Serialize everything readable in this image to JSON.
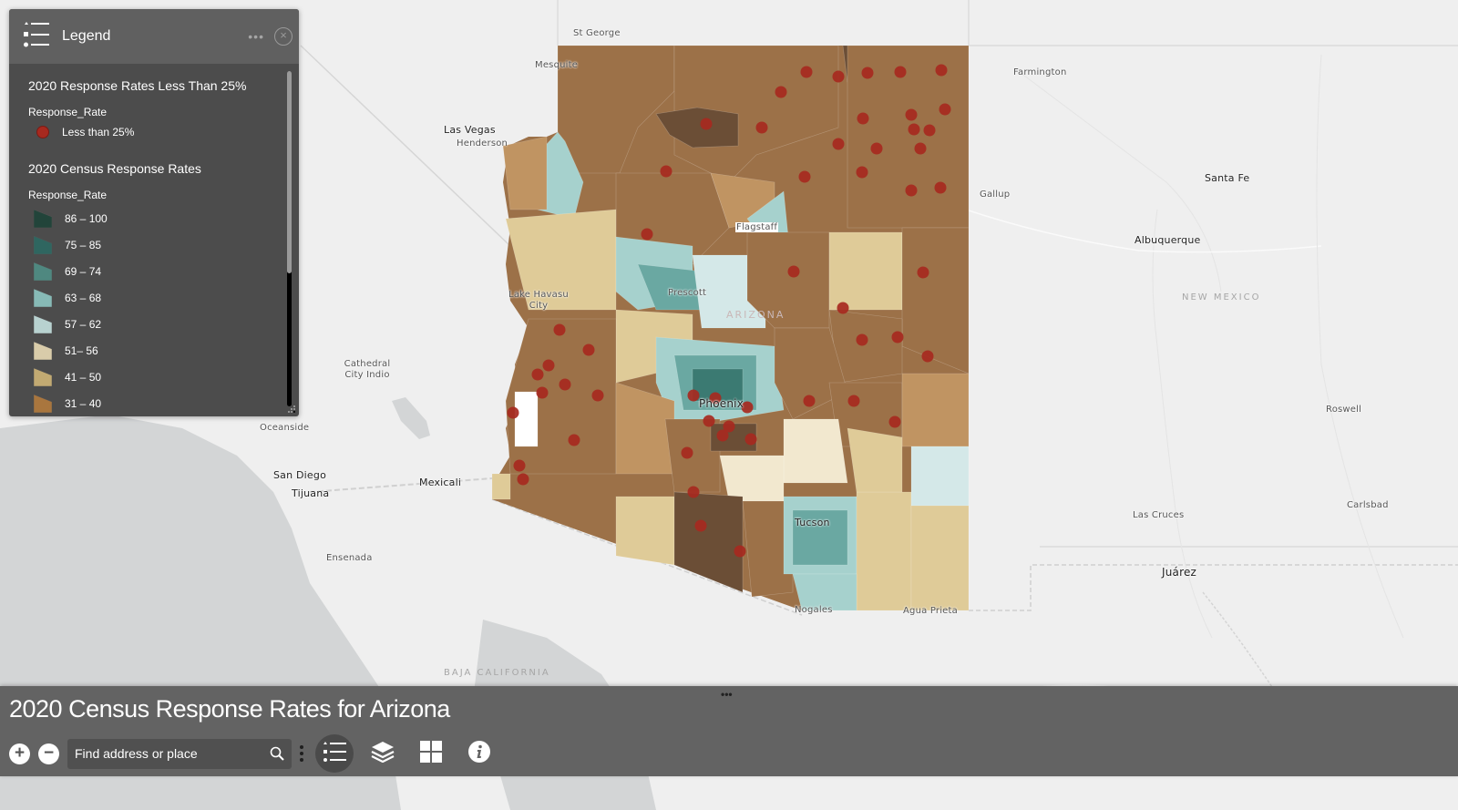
{
  "app": {
    "title": "2020 Census Response Rates for Arizona"
  },
  "legend": {
    "title": "Legend",
    "more_label": "•••",
    "close_label": "×",
    "layers": [
      {
        "name": "2020 Response Rates Less Than 25%",
        "field": "Response_Rate",
        "items": [
          {
            "label": "Less than 25%",
            "color": "#a7291f",
            "symbol": "circle"
          }
        ]
      },
      {
        "name": "2020 Census Response Rates",
        "field": "Response_Rate",
        "items": [
          {
            "label": "86 – 100",
            "color": "#22443a"
          },
          {
            "label": "75 – 85",
            "color": "#2f6660"
          },
          {
            "label": "69 – 74",
            "color": "#4f8880"
          },
          {
            "label": "63 – 68",
            "color": "#87bab6"
          },
          {
            "label": "57 – 62",
            "color": "#b8d2d0"
          },
          {
            "label": "51– 56",
            "color": "#d9ccaa"
          },
          {
            "label": "41 – 50",
            "color": "#c2aa72"
          },
          {
            "label": "31 – 40",
            "color": "#a9763e"
          }
        ]
      }
    ]
  },
  "toolbar": {
    "zoom_in_label": "+",
    "zoom_out_label": "−",
    "search_placeholder": "Find address or place",
    "search_value": "",
    "buttons": [
      {
        "name": "legend",
        "icon": "legend-list-icon",
        "active": true
      },
      {
        "name": "layers",
        "icon": "layers-icon",
        "active": false
      },
      {
        "name": "basemap-gallery",
        "icon": "grid-icon",
        "active": false
      },
      {
        "name": "about",
        "icon": "info-icon",
        "active": false
      }
    ]
  },
  "map": {
    "state_label": "ARIZONA",
    "places": [
      {
        "name": "St George",
        "type": "minor"
      },
      {
        "name": "Mesquite",
        "type": "minor"
      },
      {
        "name": "Las Vegas",
        "type": "city"
      },
      {
        "name": "Henderson",
        "type": "minor"
      },
      {
        "name": "Farmington",
        "type": "minor"
      },
      {
        "name": "Gallup",
        "type": "minor"
      },
      {
        "name": "Santa Fe",
        "type": "city"
      },
      {
        "name": "Albuquerque",
        "type": "city"
      },
      {
        "name": "Flagstaff",
        "type": "minor"
      },
      {
        "name": "Prescott",
        "type": "minor"
      },
      {
        "name": "Lake Havasu City",
        "type": "minor"
      },
      {
        "name": "Phoenix",
        "type": "city"
      },
      {
        "name": "Tucson",
        "type": "city"
      },
      {
        "name": "Nogales",
        "type": "minor"
      },
      {
        "name": "Agua Prieta",
        "type": "minor"
      },
      {
        "name": "Cathedral City Indio",
        "type": "minor"
      },
      {
        "name": "Oceanside",
        "type": "minor"
      },
      {
        "name": "San Diego",
        "type": "city"
      },
      {
        "name": "Tijuana",
        "type": "city"
      },
      {
        "name": "Mexicali",
        "type": "city"
      },
      {
        "name": "Ensenada",
        "type": "minor"
      },
      {
        "name": "Las Cruces",
        "type": "minor"
      },
      {
        "name": "Juárez",
        "type": "city"
      },
      {
        "name": "Roswell",
        "type": "minor"
      },
      {
        "name": "Carlsbad",
        "type": "minor"
      },
      {
        "name": "NEW MEXICO",
        "type": "region"
      },
      {
        "name": "BAJA CALIFORNIA",
        "type": "region"
      }
    ]
  }
}
